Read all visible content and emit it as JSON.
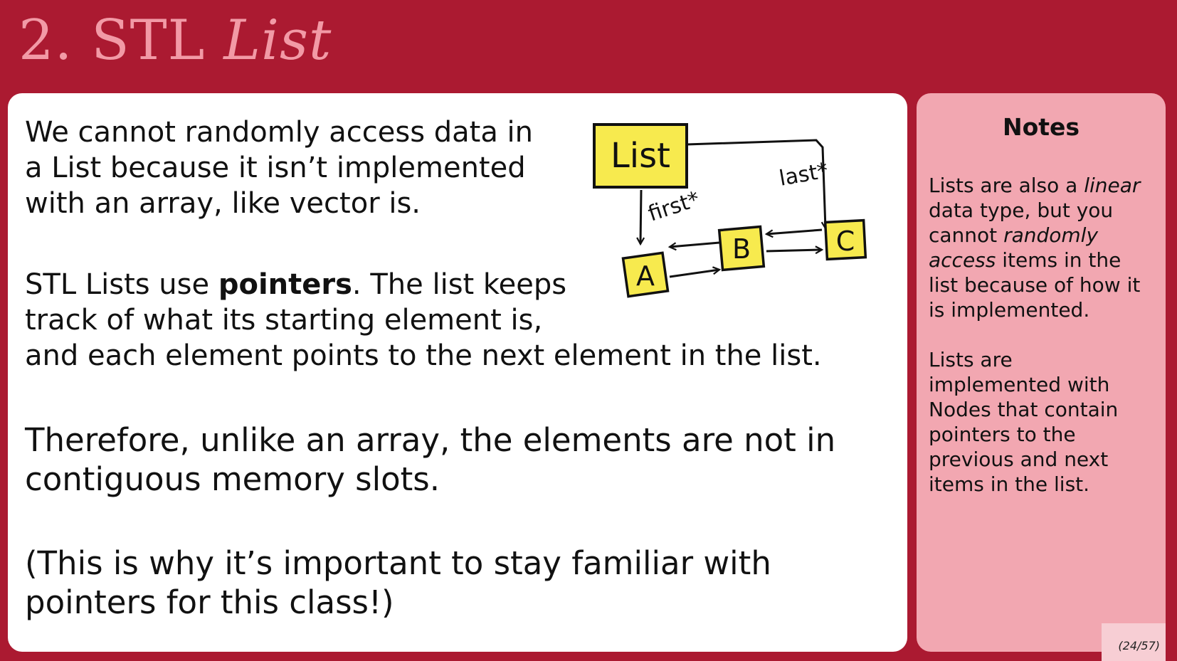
{
  "slide": {
    "title_num": "2.",
    "title_stl": "STL",
    "title_list": "List"
  },
  "main": {
    "p1": [
      "We cannot randomly access data in",
      "a List because it isn’t implemented",
      "with an array, like vector is."
    ],
    "p2": {
      "l1_a": "STL Lists use ",
      "l1_bold": "pointers",
      "l1_b": ". The list keeps",
      "l2": "track of what its starting element is,",
      "l3": "and each element points to the next element in the list."
    },
    "p3": [
      "Therefore, unlike an array, the elements are not in",
      "contiguous memory slots."
    ],
    "p4": [
      "(This is why it’s important to stay familiar with",
      "pointers for this class!)"
    ]
  },
  "diagram": {
    "list_label": "List",
    "first_label": "first*",
    "last_label": "last*",
    "node_a": "A",
    "node_b": "B",
    "node_c": "C",
    "box_fill": "#f7ea4e"
  },
  "notes": {
    "title": "Notes",
    "n1": {
      "l1_a": "Lists are also a ",
      "l1_i": "linear",
      "l2": "data type, but you",
      "l3_a": "cannot ",
      "l3_i": "randomly",
      "l4_i": "access",
      "l4_b": " items in the",
      "l5": "list because of how it",
      "l6": "is implemented."
    },
    "n2": [
      "Lists are",
      "implemented with",
      "Nodes that contain",
      "pointers to the",
      "previous and next",
      "items in the list."
    ]
  },
  "page_number": "(24/57)",
  "colors": {
    "background": "#ab1a31",
    "title": "#f29aa6",
    "main_panel": "#ffffff",
    "notes_panel": "#f2a7b1"
  }
}
